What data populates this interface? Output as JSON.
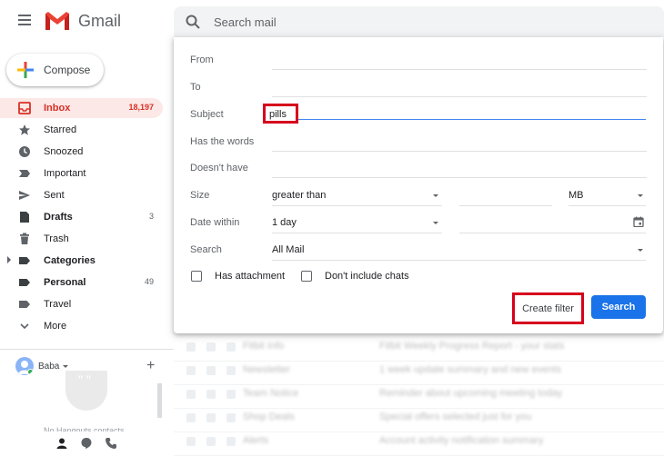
{
  "app": {
    "brand": "Gmail",
    "logo_icon": "gmail-logo-icon"
  },
  "colors": {
    "accent_red": "#d93025",
    "inbox_bg": "#fce8e6",
    "primary_blue": "#1a73e8",
    "highlight_red": "#d6001c"
  },
  "search": {
    "placeholder": "Search mail"
  },
  "compose": {
    "label": "Compose"
  },
  "sidebar": {
    "items": [
      {
        "label": "Inbox",
        "count": "18,197",
        "icon": "inbox-icon"
      },
      {
        "label": "Starred",
        "count": "",
        "icon": "star-icon"
      },
      {
        "label": "Snoozed",
        "count": "",
        "icon": "clock-icon"
      },
      {
        "label": "Important",
        "count": "",
        "icon": "important-icon"
      },
      {
        "label": "Sent",
        "count": "",
        "icon": "send-icon"
      },
      {
        "label": "Drafts",
        "count": "3",
        "icon": "draft-icon"
      },
      {
        "label": "Trash",
        "count": "",
        "icon": "trash-icon"
      },
      {
        "label": "Categories",
        "count": "",
        "icon": "label-icon"
      },
      {
        "label": "Personal",
        "count": "49",
        "icon": "label-icon"
      },
      {
        "label": "Travel",
        "count": "",
        "icon": "label-icon"
      },
      {
        "label": "More",
        "count": "",
        "icon": "chevron-down-icon"
      }
    ]
  },
  "hangouts": {
    "user": "Baba",
    "empty": "No Hangouts contacts"
  },
  "filter": {
    "from_label": "From",
    "to_label": "To",
    "subject_label": "Subject",
    "subject_value": "pills",
    "has_words_label": "Has the words",
    "doesnt_have_label": "Doesn't have",
    "size_label": "Size",
    "size_op": "greater than",
    "size_unit": "MB",
    "date_label": "Date within",
    "date_value": "1 day",
    "search_label": "Search",
    "search_value": "All Mail",
    "has_attachment": "Has attachment",
    "no_chats": "Don't include chats",
    "create_filter": "Create filter",
    "search_button": "Search"
  },
  "emails": [
    {
      "sender": "Fitbit Info",
      "subject": "Fitbit Weekly Progress Report - your stats"
    },
    {
      "sender": "Newsletter",
      "subject": "1 week update summary and new events"
    },
    {
      "sender": "Team Notice",
      "subject": "Reminder about upcoming meeting today"
    },
    {
      "sender": "Shop Deals",
      "subject": "Special offers selected just for you"
    },
    {
      "sender": "Alerts",
      "subject": "Account activity notification summary"
    }
  ]
}
